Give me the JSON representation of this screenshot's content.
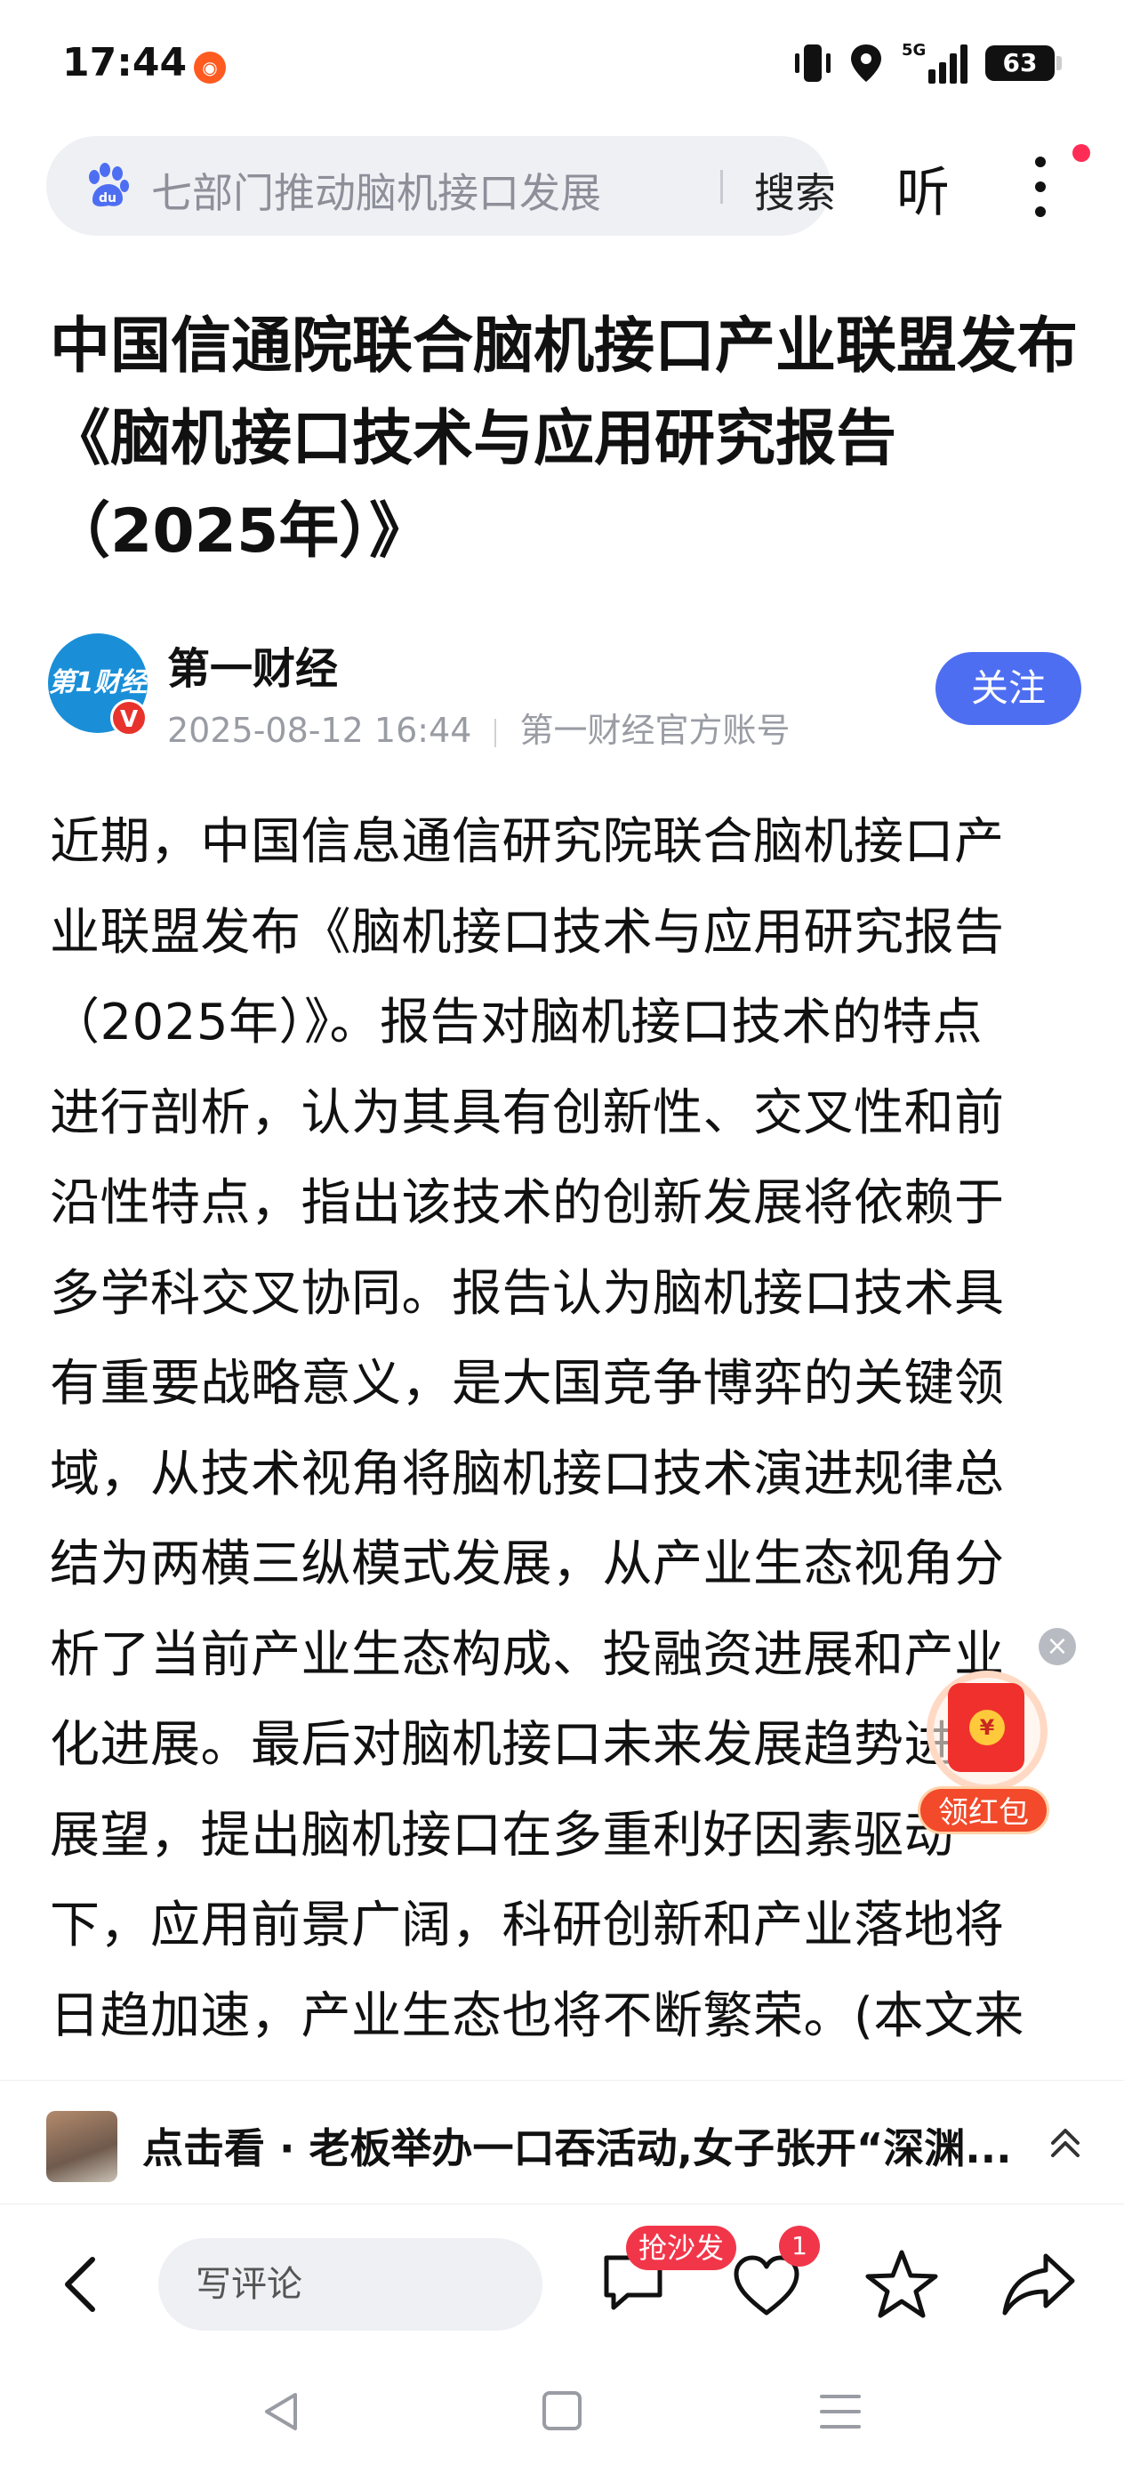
{
  "status_bar": {
    "time": "17:44",
    "signal_label": "5G",
    "battery": "63"
  },
  "search": {
    "query": "七部门推动脑机接口发展",
    "button_label": "搜索"
  },
  "header": {
    "listen_label": "听"
  },
  "article": {
    "title": "中国信通院联合脑机接口产业联盟发布《脑机接口技术与应用研究报告（2025年）》",
    "author": {
      "avatar_text": "第1财经",
      "verified_mark": "V",
      "name": "第一财经",
      "date": "2025-08-12 16:44",
      "account_type": "第一财经官方账号",
      "follow_label": "关注"
    },
    "body_lines": [
      "近期，中国信息通信研究院联合脑机接口产",
      "业联盟发布《脑机接口技术与应用研究报告",
      "（2025年）》。报告对脑机接口技术的特点",
      "进行剖析，认为其具有创新性、交叉性和前",
      "沿性特点，指出该技术的创新发展将依赖于",
      "多学科交叉协同。报告认为脑机接口技术具",
      "有重要战略意义，是大国竞争博弈的关键领",
      "域，从技术视角将脑机接口技术演进规律总",
      "结为两横三纵模式发展，从产业生态视角分",
      "析了当前产业生态构成、投融资进展和产业",
      "化进展。最后对脑机接口未来发展趋势进行",
      "展望，提出脑机接口在多重利好因素驱动",
      "下，应用前景广阔，科研创新和产业落地将",
      "日趋加速，产业生态也将不断繁荣。(本文来"
    ]
  },
  "red_packet": {
    "label": "领红包",
    "coin": "¥"
  },
  "recommended": {
    "text": "点击看 · 老板举办一口吞活动,女子张开“深渊..."
  },
  "action_bar": {
    "comment_placeholder": "写评论",
    "sofa_badge": "抢沙发",
    "like_count": "1"
  },
  "colors": {
    "accent": "#4e6ef2",
    "badge_red": "#f2364a",
    "search_bg": "#eff0f4"
  }
}
